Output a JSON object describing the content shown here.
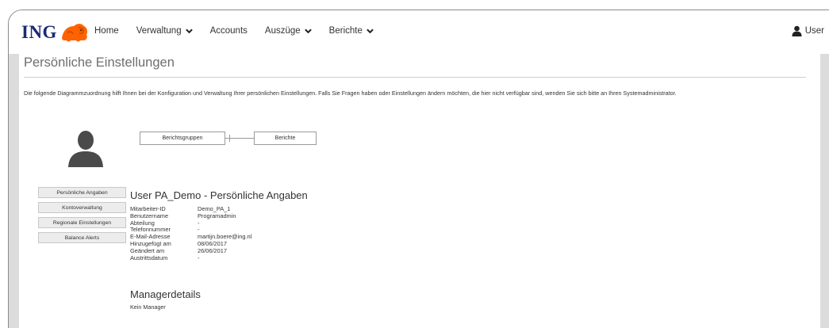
{
  "brand": {
    "logo_text": "ING",
    "accent": "#ff6200",
    "navy": "#1b2a73"
  },
  "nav": {
    "items": [
      {
        "label": "Home",
        "dropdown": false
      },
      {
        "label": "Verwaltung",
        "dropdown": true
      },
      {
        "label": "Accounts",
        "dropdown": false
      },
      {
        "label": "Auszüge",
        "dropdown": true
      },
      {
        "label": "Berichte",
        "dropdown": true
      }
    ],
    "user_label": "User"
  },
  "page": {
    "title": "Persönliche Einstellungen",
    "intro": "Die folgende Diagrammzuordnung hilft Ihnen bei der Konfiguration und Verwaltung Ihrer persönlichen Einstellungen. Falls Sie Fragen haben oder Einstellungen ändern möchten, die hier nicht verfügbar sind, wenden Sie sich bitte an Ihren Systemadministrator."
  },
  "diagram": {
    "box1": "Berichtsgruppen",
    "box2": "Berichte"
  },
  "sidebar": {
    "items": [
      {
        "label": "Persönliche Angaben"
      },
      {
        "label": "Kontoverwaltung"
      },
      {
        "label": "Regionale Einstellungen"
      },
      {
        "label": "Balance Alerts"
      }
    ]
  },
  "details": {
    "heading": "User PA_Demo - Persönliche Angaben",
    "rows": [
      {
        "key": "Mitarbeiter-ID",
        "value": "Demo_PA_1"
      },
      {
        "key": "Benutzername",
        "value": "Programadmin"
      },
      {
        "key": "Abteilung",
        "value": "-"
      },
      {
        "key": "Telefonnummer",
        "value": "-"
      },
      {
        "key": "E-Mail-Adresse",
        "value": "martijn.boere@ing.nl"
      },
      {
        "key": "Hinzugefügt am",
        "value": "08/06/2017"
      },
      {
        "key": "Geändert am",
        "value": "26/06/2017"
      },
      {
        "key": "Austrittsdatum",
        "value": "-"
      }
    ]
  },
  "manager": {
    "heading": "Managerdetails",
    "value": "Kein Manager"
  },
  "icons": {
    "logo": "ing-lion-logo-icon",
    "chevron": "chevron-down-icon",
    "user": "user-icon",
    "avatar": "avatar-silhouette-icon"
  }
}
